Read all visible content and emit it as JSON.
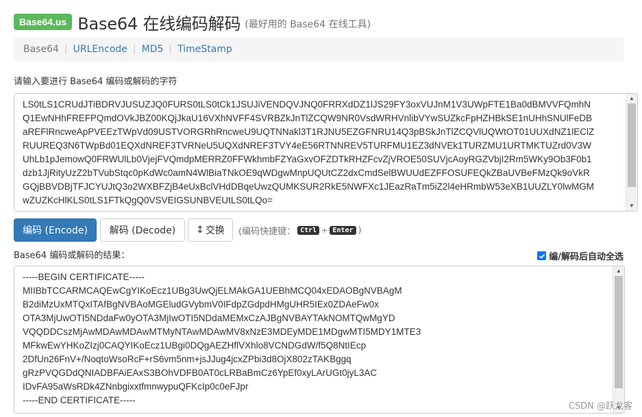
{
  "header": {
    "logo": "Base64.us",
    "title": "Base64 在线编码解码",
    "subtitle": "(最好用的 Base64 在线工具)"
  },
  "nav": {
    "items": [
      {
        "label": "Base64",
        "active": true
      },
      {
        "label": "URLEncode",
        "active": false
      },
      {
        "label": "MD5",
        "active": false
      },
      {
        "label": "TimeStamp",
        "active": false
      }
    ],
    "separator": "|"
  },
  "input": {
    "label": "请输入要进行 Base64 编码或解码的字符",
    "lines": [
      "LS0tLS1CRUdJTiBDRVJUSUZJQ0FURS0tLS0tCk1JSUJiVENDQVJNQ0FRRXdDZ1lJS29FY3oxVUJnM1V3UWpFTE1Ba0dBMVVFQmhN",
      "Q1EwNHhFREFPQmdOVkJBZ00KQjJkaU16VXhNVFF4SVRBZkJnTlZCQW9NR0VsdWRHVnlibVYwSUZkcFpHZHBkSE1nUHhSNUlFeDB",
      "aREFlRncweApPVEEzTWpVd09USTVORGRhRncweU9UQTNNakl3T1RJNU5EZGFNRU14Q3pBSkJnTlZCQVlUQWtOT01UUXdNZ1lEClZ",
      "RUUREQ3N6TWpBd01EQXdNREF3TVRNeU5UQXdNREF3TVY4eE56RTNNREV5TURFMU1EZ3dNVEk1TURZMU1URTMKTUZrd0V3W",
      "UhLb1pJemowQ0FRWUlLb0VjejFVQmdpMERRZ0FFWkhmbFZYaGxvOFZDTkRHZFcvZjVROE50SUVjcAoyRGZVbjI2Rm5WKy9Ob3F0b1",
      "dzb1JjRityUzZ2bTVubStqc0pKdWc0amN4WlBiaTNkOE9qWDgwMnpUQUtCZ2dxCmdSelBWUUdEZFFOSUFEQkZBaUVBeFMzQk9oVkR",
      "GQjBBVDBjTFJCYUJtQ3o2WXBFZjB4eUxBclVHdDBqeUwzQUMKSUR2RkE5NWFXc1JEazRaTm5iZ2l4eHRmbW53eXB1UUZLY0lwMGM",
      "wZUZKcHlKLS0tLS1FTkQgQ0VSVEIGSUNBVEUtLS0tLQo="
    ],
    "scrollbar": {
      "thumb_start": 0.0,
      "thumb_end": 0.85
    }
  },
  "buttons": {
    "encode": "编码 (Encode)",
    "decode": "解码 (Decode)",
    "swap": "交换",
    "swap_icon": "↕"
  },
  "shortcut": {
    "prefix": "(编码快捷键：",
    "key1": "Ctrl",
    "plus": "+",
    "key2": "Enter",
    "suffix": ")"
  },
  "output": {
    "label": "Base64 编码或解码的结果：",
    "auto_select_label": "编/解码后自动全选",
    "auto_select_checked": true,
    "lines": [
      "-----BEGIN CERTIFICATE-----",
      "MIIBbTCCARMCAQEwCgYIKoEcz1UBg3UwQjELMAkGA1UEBhMCQ04xEDAOBgNVBAgM",
      "B2diMzUxMTQxITAfBgNVBAoMGEludGVybmV0IFdpZGdpdHMgUHR5IEx0ZDAeFw0x",
      "OTA3MjUwOTI5NDdaFw0yOTA3MjIwOTI5NDdaMEMxCzAJBgNVBAYTAkNOMTQwMgYD",
      "VQQDDCszMjAwMDAwMDAwMTMyNTAwMDAwMV8xNzE3MDEyMDE1MDgwMTI5MDY1MTE3",
      "MFkwEwYHKoZIzj0CAQYIKoEcz1UBgi0DQgAEZHflVXhlo8VCNDGdW/f5Q8NtIEcp",
      "2DfUn26FnV+/NoqtoWsoRcF+rS6vm5nm+jsJJug4jcxZPbi3d8OjX802zTAKBggq",
      "gRzPVQGDdQNIADBFAiEAxS3BOhVDFB0AT0cLRBaBmCz6YpEf0xyLArUGt0jyL3AC",
      "IDvFA95aWsRDk4ZNnbgixxtfmnwypuQFKcIp0c0eFJpr",
      "-----END CERTIFICATE-----"
    ],
    "scrollbar": {
      "thumb_start": 0.0,
      "thumb_end": 0.88
    }
  },
  "watermark": "CSDN @跃龙客",
  "colors": {
    "brand_green": "#5cb85c",
    "primary_blue": "#337ab7",
    "link_blue": "#337ab7",
    "checkbox_blue": "#0075ff"
  }
}
